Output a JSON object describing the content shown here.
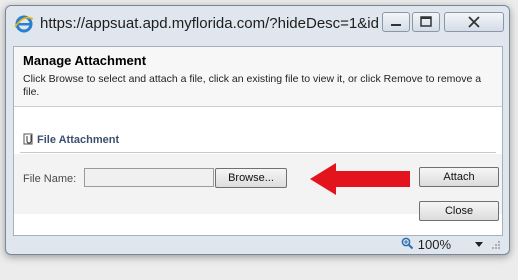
{
  "window": {
    "url": "https://appsuat.apd.myflorida.com/?hideDesc=1&id..."
  },
  "dialog": {
    "title": "Manage Attachment",
    "description": "Click Browse to select and attach a file, click an existing file to view it, or click Remove to remove a file.",
    "section_label": "File Attachment",
    "file_name_label": "File Name:",
    "file_value": "",
    "browse_label": "Browse...",
    "attach_label": "Attach",
    "close_label": "Close"
  },
  "status": {
    "zoom": "100%"
  },
  "colors": {
    "arrow": "#e3141b",
    "section_text": "#3b5070"
  },
  "icons": {
    "browser": "ie-icon",
    "section": "paperclip-icon",
    "zoom": "zoom-icon"
  }
}
